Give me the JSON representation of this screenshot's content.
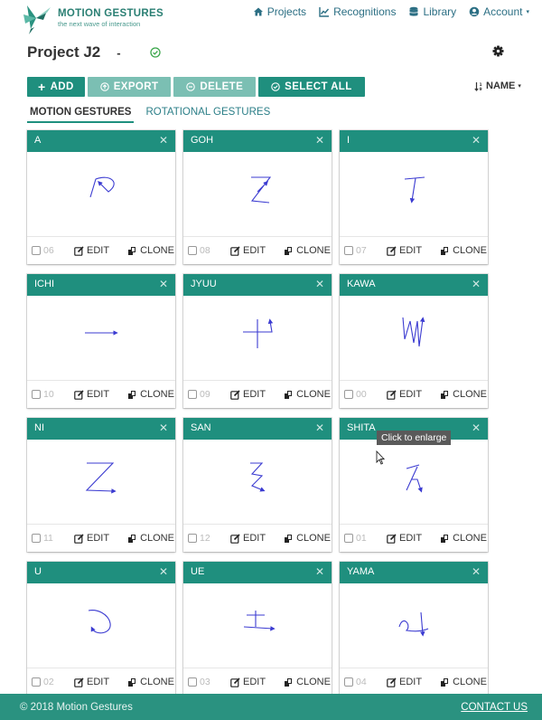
{
  "brand": {
    "name": "MOTION GESTURES",
    "tagline": "the next wave of interaction",
    "logo_icon": "hummingbird-logo"
  },
  "nav": [
    {
      "label": "Projects",
      "icon": "home-icon"
    },
    {
      "label": "Recognitions",
      "icon": "chart-line-icon"
    },
    {
      "label": "Library",
      "icon": "database-icon"
    },
    {
      "label": "Account",
      "icon": "user-circle-icon"
    }
  ],
  "project": {
    "title": "Project J2",
    "dash": "-",
    "status_icon": "check-circle-icon",
    "settings_icon": "gear-icon"
  },
  "toolbar": {
    "add": "ADD",
    "export": "EXPORT",
    "delete": "DELETE",
    "select_all": "SELECT ALL",
    "sort": "NAME"
  },
  "tabs": [
    {
      "label": "MOTION GESTURES",
      "active": true
    },
    {
      "label": "ROTATIONAL GESTURES",
      "active": false
    }
  ],
  "cards": [
    {
      "name": "A",
      "number": "06"
    },
    {
      "name": "GOH",
      "number": "08"
    },
    {
      "name": "I",
      "number": "07"
    },
    {
      "name": "ICHI",
      "number": "10"
    },
    {
      "name": "JYUU",
      "number": "09"
    },
    {
      "name": "KAWA",
      "number": "00"
    },
    {
      "name": "NI",
      "number": "11"
    },
    {
      "name": "SAN",
      "number": "12"
    },
    {
      "name": "SHITA",
      "number": "01"
    },
    {
      "name": "U",
      "number": "02"
    },
    {
      "name": "UE",
      "number": "03"
    },
    {
      "name": "YAMA",
      "number": "04"
    }
  ],
  "card_actions": {
    "edit": "EDIT",
    "clone": "CLONE"
  },
  "tooltip": "Click to enlarge",
  "footer": {
    "copyright": "© 2018 Motion Gestures",
    "contact": "CONTACT US"
  },
  "colors": {
    "teal": "#1f8f7e",
    "teal_light": "#7bbfb3",
    "stroke": "#3b3bd1",
    "footer": "#2a9280"
  }
}
